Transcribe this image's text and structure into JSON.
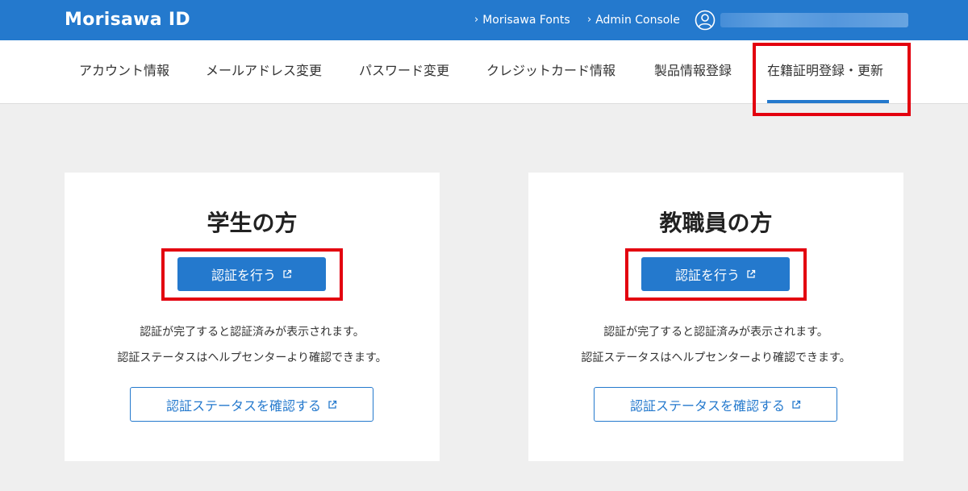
{
  "header": {
    "brand": "Morisawa ID",
    "links": [
      {
        "label": "Morisawa Fonts",
        "icon": "chevron-right-icon"
      },
      {
        "label": "Admin Console",
        "icon": "chevron-right-icon"
      }
    ],
    "user_icon": "user-circle-icon",
    "colors": {
      "bar": "#2479cd"
    }
  },
  "nav": {
    "tabs": [
      {
        "label": "アカウント情報"
      },
      {
        "label": "メールアドレス変更"
      },
      {
        "label": "パスワード変更"
      },
      {
        "label": "クレジットカード情報"
      },
      {
        "label": "製品情報登録"
      },
      {
        "label": "在籍証明登録・更新",
        "active": true
      }
    ]
  },
  "cards": [
    {
      "title": "学生の方",
      "verify_label": "認証を行う",
      "note_1": "認証が完了すると認証済みが表示されます。",
      "note_2": "認証ステータスはヘルプセンターより確認できます。",
      "status_label": "認証ステータスを確認する"
    },
    {
      "title": "教職員の方",
      "verify_label": "認証を行う",
      "note_1": "認証が完了すると認証済みが表示されます。",
      "note_2": "認証ステータスはヘルプセンターより確認できます。",
      "status_label": "認証ステータスを確認する"
    }
  ],
  "colors": {
    "accent": "#2479cd",
    "highlight": "#e3000f",
    "page_bg": "#efefef"
  }
}
